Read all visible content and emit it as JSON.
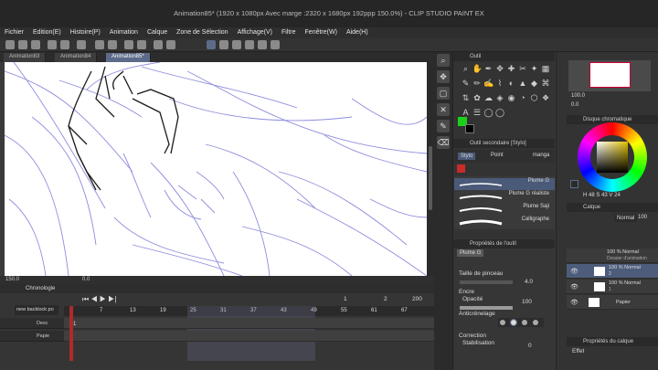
{
  "window": {
    "title": "Animation85* (1920 x 1080px Avec marge :2320 x 1680px 192ppp 150.0%) - CLIP STUDIO PAINT EX"
  },
  "menu": [
    "Fichier",
    "Edition(E)",
    "Histoire(P)",
    "Animation",
    "Calque",
    "Zone de Sélection",
    "Affichage(V)",
    "Filtre",
    "Fenêtre(W)",
    "Aide(H)"
  ],
  "tabs": [
    "Animation83",
    "Animation84",
    "Animation85*"
  ],
  "statusbar": {
    "zoom": "150.0",
    "rotation": "0.0"
  },
  "timeline": {
    "label": "Chronologie",
    "track_name": "new backlock po",
    "frame_markers": [
      "1",
      "7",
      "13",
      "19",
      "25",
      "31",
      "37",
      "43",
      "49",
      "55",
      "61",
      "67"
    ],
    "current_frame": "1",
    "total_frames": "2",
    "end_frame": "200",
    "layers": [
      "Desc",
      "Papie"
    ],
    "row_numbers": [
      "1",
      "2"
    ]
  },
  "tool_panel": {
    "label": "Outil"
  },
  "subtool_panel": {
    "label": "Outil secondaire [Stylo]",
    "tabs": [
      "Stylo",
      "Point",
      "manga"
    ],
    "brushes": [
      "Plume G",
      "Plume G réaliste",
      "Plume Saji",
      "Calligraphe"
    ],
    "selected_brush": "Plume G"
  },
  "props": {
    "label": "Propriétés de l'outil",
    "brush_name": "Plume G",
    "size_label": "Taille de pinceau",
    "size_value": "4.0",
    "opacity_section": "Encre",
    "opacity_label": "Opacité",
    "opacity_value": "100",
    "antialias_label": "Anticrénelage",
    "correction_label": "Correction",
    "stabilization_label": "Stabilisation",
    "stabilization_value": "0"
  },
  "navigator": {
    "zoom": "100.0",
    "rotation": "0.0"
  },
  "color_panel": {
    "label": "Disque chromatique",
    "values": [
      "H",
      "48",
      "S",
      "43",
      "V",
      "24"
    ],
    "hue_value": "48",
    "sat_value": "43",
    "val_value": "24"
  },
  "layer_panel": {
    "label": "Calque",
    "blend_mode": "Normal",
    "opacity": "100",
    "layers": [
      {
        "name": "100 % Normal",
        "sub": "Dossier d'animation"
      },
      {
        "name": "100 % Normal",
        "sub": "2"
      },
      {
        "name": "100 % Normal",
        "sub": "1"
      },
      {
        "name": "Papier",
        "sub": ""
      }
    ]
  },
  "layer_props": {
    "label": "Propriétés du calque",
    "effect_label": "Effet"
  },
  "colors": {
    "accent": "#5d6b8a",
    "sketch_blue": "#7a78d8",
    "ink": "#1a1a1a"
  }
}
